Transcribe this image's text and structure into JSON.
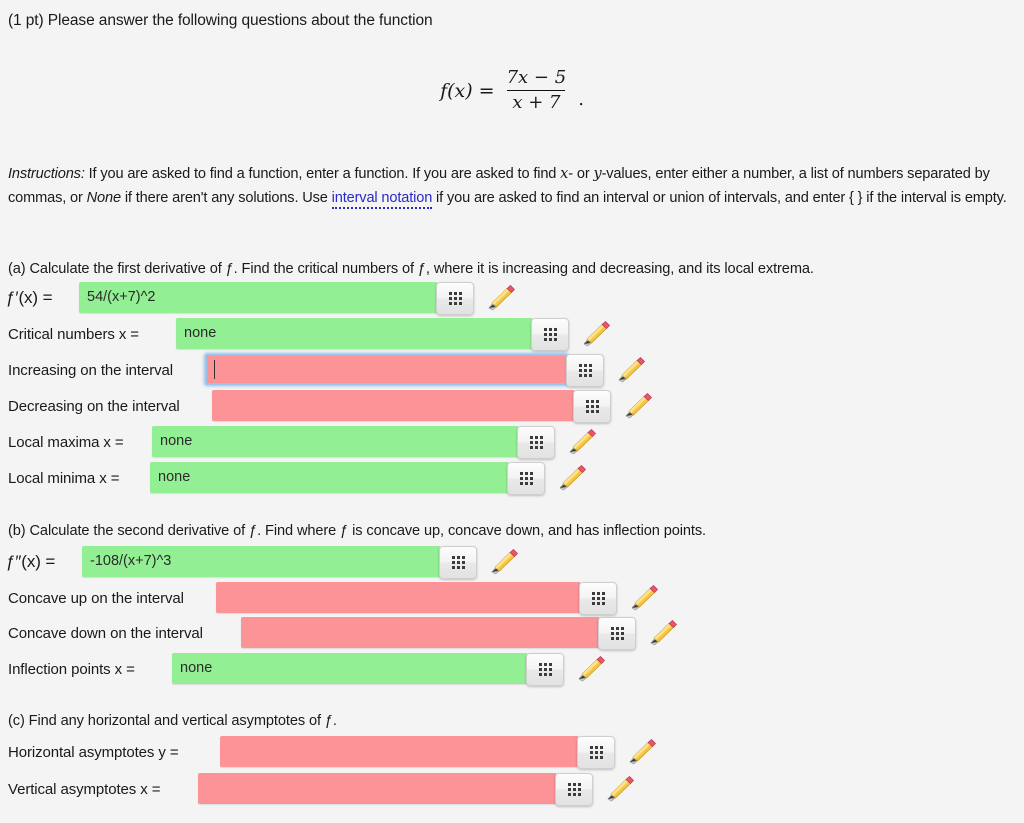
{
  "header": {
    "points": "(1 pt)",
    "prompt": "Please answer the following questions about the function"
  },
  "formula": {
    "lhs": "f(x) =",
    "numerator": "7x − 5",
    "denominator": "x + 7",
    "trailing": "."
  },
  "instructions": {
    "label": "Instructions:",
    "text_1": " If you are asked to find a function, enter a function. If you are asked to find ",
    "var_x": "x",
    "text_2": "- or ",
    "var_y": "y",
    "text_3": "-values, enter either a number, a list of numbers separated by commas, or ",
    "none_word": "None",
    "text_4": " if there aren't any solutions. Use ",
    "link": "interval notation",
    "text_5": " if you are asked to find an interval or union of intervals, and enter { } if the interval is empty."
  },
  "sections": {
    "a": "(a) Calculate the first derivative of ƒ. Find the critical numbers of ƒ, where it is increasing and decreasing, and its local extrema.",
    "b": "(b) Calculate the second derivative of ƒ. Find where ƒ is concave up, concave down, and has inflection points.",
    "c": "(c) Find any horizontal and vertical asymptotes of ƒ."
  },
  "colors": {
    "correct": "#93ef93",
    "wrong": "#fb9397",
    "focus_ring": "#9bc4ea",
    "link": "#2a2ac8",
    "page_bg": "#f4f4f4"
  },
  "icons": {
    "grid": "grid-keyboard-icon",
    "pencil": "pencil-icon"
  },
  "rows": [
    {
      "id": "first-derivative",
      "label": "ƒ′(x) =",
      "value": "54/(x+7)^2",
      "state": "correct",
      "focused": false
    },
    {
      "id": "critical-numbers",
      "label": "Critical numbers x =",
      "value": "none",
      "state": "correct",
      "focused": false
    },
    {
      "id": "increasing-interval",
      "label": "Increasing on the interval",
      "value": "",
      "state": "wrong",
      "focused": true
    },
    {
      "id": "decreasing-interval",
      "label": "Decreasing on the interval",
      "value": "",
      "state": "wrong",
      "focused": false
    },
    {
      "id": "local-maxima",
      "label": "Local maxima x =",
      "value": "none",
      "state": "correct",
      "focused": false
    },
    {
      "id": "local-minima",
      "label": "Local minima x =",
      "value": "none",
      "state": "correct",
      "focused": false
    },
    {
      "id": "second-derivative",
      "label": "ƒ″(x) =",
      "value": "-108/(x+7)^3",
      "state": "correct",
      "focused": false
    },
    {
      "id": "concave-up",
      "label": "Concave up on the interval",
      "value": "",
      "state": "wrong",
      "focused": false
    },
    {
      "id": "concave-down",
      "label": "Concave down on the interval",
      "value": "",
      "state": "wrong",
      "focused": false
    },
    {
      "id": "inflection-points",
      "label": "Inflection points x =",
      "value": "none",
      "state": "correct",
      "focused": false
    },
    {
      "id": "horizontal-asymptotes",
      "label": "Horizontal asymptotes y =",
      "value": "",
      "state": "wrong",
      "focused": false
    },
    {
      "id": "vertical-asymptotes",
      "label": "Vertical asymptotes x =",
      "value": "",
      "state": "wrong",
      "focused": false
    }
  ]
}
